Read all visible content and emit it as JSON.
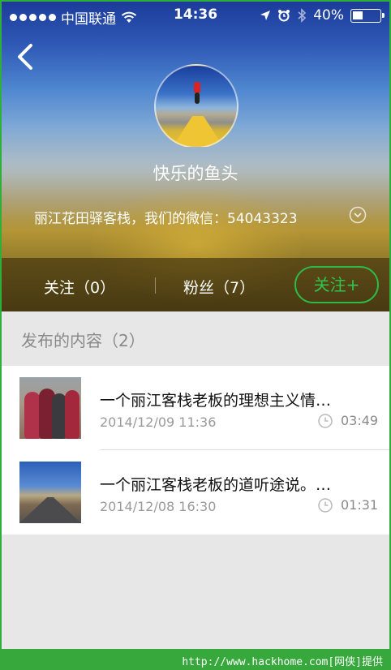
{
  "status_bar": {
    "carrier": "中国联通",
    "time": "14:36",
    "battery_percent": "40%",
    "battery_level": 0.4,
    "icons": [
      "signal-dots-icon",
      "wifi-icon",
      "location-arrow-icon",
      "alarm-icon",
      "bluetooth-icon",
      "battery-icon"
    ]
  },
  "profile": {
    "username": "快乐的鱼头",
    "bio": "丽江花田驿客栈，我们的微信：54043323"
  },
  "stats": {
    "following_label": "关注（0）",
    "followers_label": "粉丝（7）",
    "follow_button_label": "关注+"
  },
  "section": {
    "title": "发布的内容（2）"
  },
  "posts": [
    {
      "title": "一个丽江客栈老板的理想主义情…",
      "date": "2014/12/09 11:36",
      "duration": "03:49"
    },
    {
      "title": "一个丽江客栈老板的道听途说。…",
      "date": "2014/12/08 16:30",
      "duration": "01:31"
    }
  ],
  "footer": {
    "watermark": "http://www.hackhome.com[网侠]提供"
  },
  "colors": {
    "accent_green": "#2dba48",
    "footer_green": "#37a83b",
    "page_background": "#e7e7e7"
  }
}
